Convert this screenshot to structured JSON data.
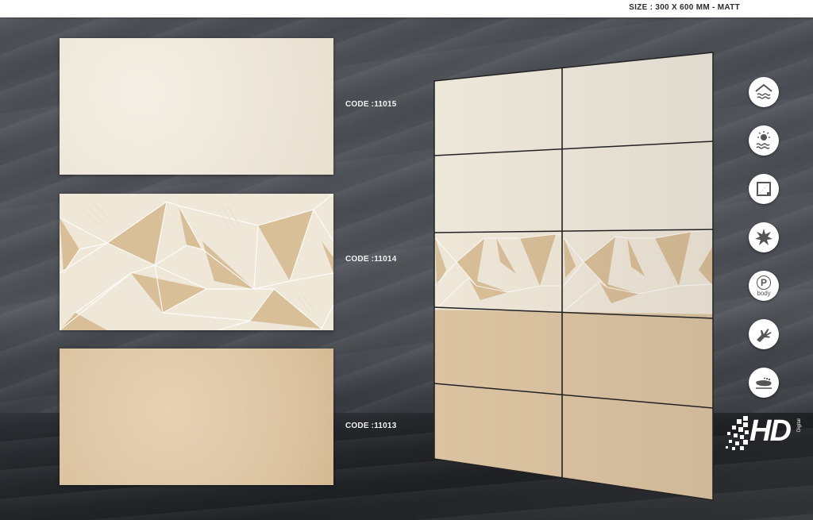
{
  "header": {
    "size_text": "SIZE : 300 X 600 MM - MATT"
  },
  "tiles": [
    {
      "code": "CODE :11015",
      "finish": "ivory"
    },
    {
      "code": "CODE :11014",
      "finish": "decor"
    },
    {
      "code": "CODE :11013",
      "finish": "beige"
    }
  ],
  "icons": [
    "wall-floor-icon",
    "weather-resistant-icon",
    "rectified-edge-icon",
    "frost-resistant-icon",
    "p-body-icon",
    "hand-touch-icon",
    "anti-slip-foot-icon"
  ],
  "icon_text": {
    "p_letter": "P",
    "p_body": "body"
  },
  "logo": {
    "text": "HD",
    "subtext": "Digital"
  },
  "colors": {
    "ivory": "#eee7d9",
    "beige": "#dcc4a2",
    "decor_accent": "#d9bf98",
    "background": "#4d5157"
  }
}
